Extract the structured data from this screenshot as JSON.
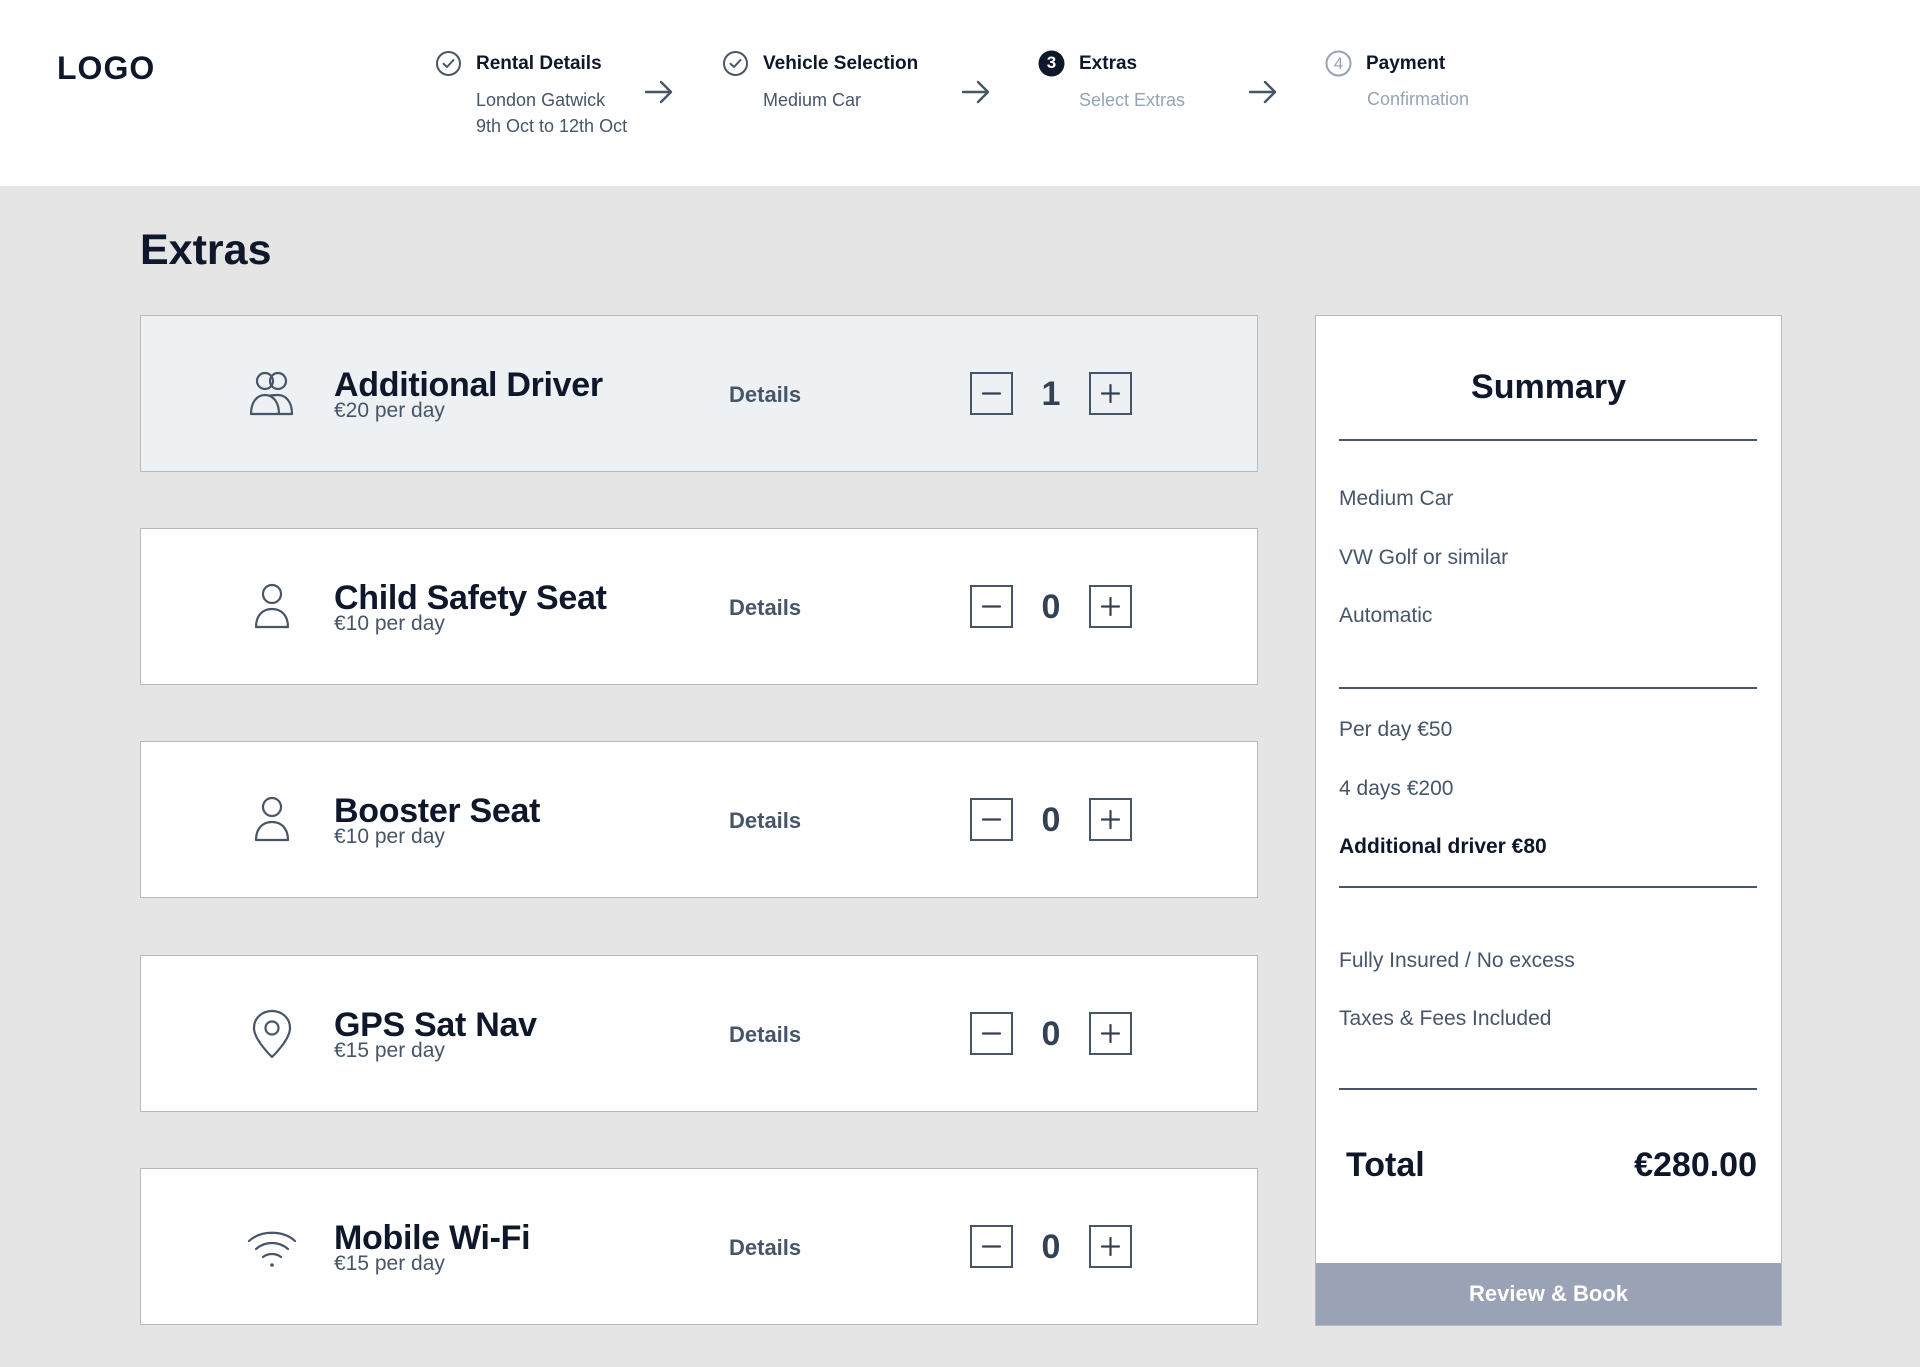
{
  "header": {
    "logo": "LOGO",
    "steps": [
      {
        "title": "Rental Details",
        "sub1": "London Gatwick",
        "sub2": "9th Oct to 12th Oct",
        "status": "completed",
        "icon": "check-circle-icon"
      },
      {
        "title": "Vehicle Selection",
        "sub1": "Medium Car",
        "status": "completed",
        "icon": "check-circle-icon"
      },
      {
        "number": "3",
        "title": "Extras",
        "sub1": "Select Extras",
        "status": "current",
        "icon": "step-number-icon"
      },
      {
        "number": "4",
        "title": "Payment",
        "sub1": "Confirmation",
        "status": "upcoming",
        "icon": "step-number-icon"
      }
    ],
    "arrow_icon": "arrow-right-icon"
  },
  "page": {
    "title": "Extras"
  },
  "extras": [
    {
      "name": "Additional Driver",
      "price": "€20 per day",
      "details": "Details",
      "quantity": "1",
      "icon": "users-icon",
      "selected": true
    },
    {
      "name": "Child Safety Seat",
      "price": "€10 per day",
      "details": "Details",
      "quantity": "0",
      "icon": "user-icon",
      "selected": false
    },
    {
      "name": "Booster Seat",
      "price": "€10 per day",
      "details": "Details",
      "quantity": "0",
      "icon": "user-icon",
      "selected": false
    },
    {
      "name": "GPS Sat Nav",
      "price": "€15 per day",
      "details": "Details",
      "quantity": "0",
      "icon": "map-pin-icon",
      "selected": false
    },
    {
      "name": "Mobile Wi-Fi",
      "price": "€15 per day",
      "details": "Details",
      "quantity": "0",
      "icon": "wifi-icon",
      "selected": false
    }
  ],
  "summary": {
    "title": "Summary",
    "vehicle": [
      "Medium Car",
      "VW Golf or similar",
      "Automatic"
    ],
    "pricing": [
      "Per day €50",
      "4 days €200",
      "Additional driver €80"
    ],
    "inclusions": [
      "Fully Insured / No excess",
      "Taxes & Fees Included"
    ],
    "total_label": "Total",
    "total_value": "€280.00",
    "button": "Review & Book"
  },
  "colors": {
    "header_bg": "#ffffff",
    "page_bg": "#e5e5e5",
    "selected_card_bg": "#eef1f4",
    "text_dark": "#0f172a",
    "text_slate": "#475569",
    "text_muted": "#94a3b8",
    "button_bg": "#9aa3b5"
  }
}
